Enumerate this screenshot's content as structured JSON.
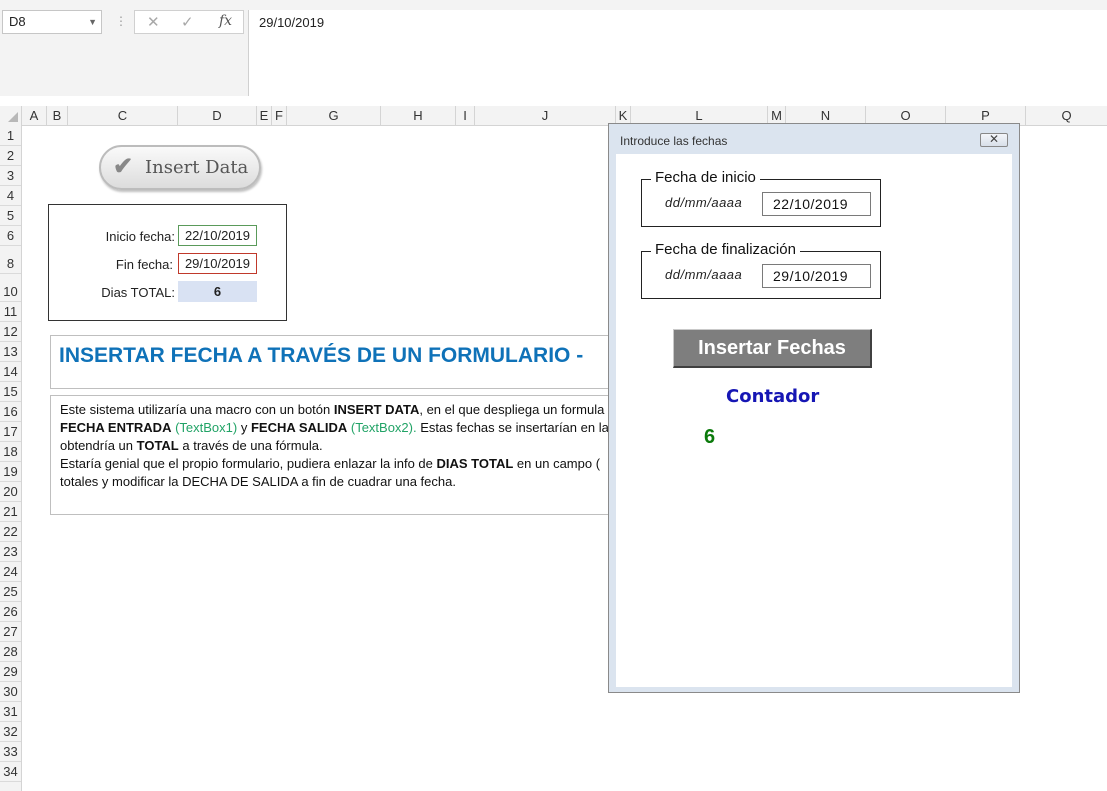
{
  "formula_bar": {
    "name_box": "D8",
    "name_box_arrow": "▼",
    "dots": "⋮",
    "cancel_glyph": "✕",
    "enter_glyph": "✓",
    "fx_glyph": "fx",
    "formula": "29/10/2019"
  },
  "columns": [
    "A",
    "B",
    "C",
    "D",
    "E",
    "F",
    "G",
    "H",
    "I",
    "J",
    "K",
    "L",
    "M",
    "N",
    "O",
    "P",
    "Q"
  ],
  "rows": [
    "1",
    "2",
    "3",
    "4",
    "5",
    "6",
    "8",
    "10",
    "11",
    "12",
    "13",
    "14",
    "15",
    "16",
    "17",
    "18",
    "19",
    "20",
    "21",
    "22",
    "23",
    "24",
    "25",
    "26",
    "27",
    "28",
    "29",
    "30",
    "31",
    "32",
    "33",
    "34"
  ],
  "sheet": {
    "insert_data_button": "Insert Data",
    "check_glyph": "✔",
    "inicio_label": "Inicio fecha:",
    "inicio_value": "22/10/2019",
    "fin_label": "Fin fecha:",
    "fin_value": "29/10/2019",
    "total_label": "Dias TOTAL:",
    "total_value": "6",
    "title": "INSERTAR FECHA A TRAVÉS DE UN FORMULARIO -",
    "desc": {
      "l1a": "Este sistema utilizaría una macro con un botón ",
      "l1b": "INSERT DATA",
      "l1c": ", en el que despliega un formula",
      "l2a": "FECHA ENTRADA",
      "l2b": " (TextBox1)",
      "l2c": " y ",
      "l2d": "FECHA SALIDA",
      "l2e": " (TextBox2).",
      "l2f": " Estas fechas se insertarían en la ce",
      "l3a": "obtendría un ",
      "l3b": "TOTAL",
      "l3c": " a través de una fórmula.",
      "l4a": "Estaría genial que el propio formulario, pudiera enlazar la info de ",
      "l4b": "DIAS TOTAL",
      "l4c": " en un campo (",
      "l5": "totales y modificar la DECHA DE SALIDA a fin de cuadrar una fecha."
    }
  },
  "dialog": {
    "title": "Introduce las fechas",
    "close_glyph": "✕",
    "frame1_legend": "Fecha de inicio",
    "frame1_format": "dd/mm/aaaa",
    "frame1_value": "22/10/2019",
    "frame2_legend": "Fecha de finalización",
    "frame2_format": "dd/mm/aaaa",
    "frame2_value": "29/10/2019",
    "insert_button": "Insertar Fechas",
    "contador_label": "Contador",
    "contador_value": "6"
  }
}
